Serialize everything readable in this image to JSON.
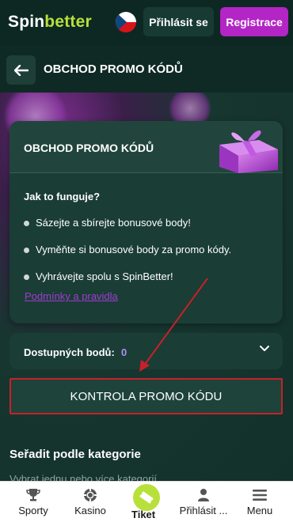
{
  "header": {
    "logo_part1": "Spin",
    "logo_part2": "better",
    "login_label": "Přihlásit se",
    "register_label": "Registrace",
    "flag_icon": "czech-flag-icon"
  },
  "page": {
    "title": "OBCHOD PROMO KÓDŮ",
    "back_icon": "arrow-left-icon"
  },
  "card": {
    "title": "OBCHOD PROMO KÓDŮ",
    "how_title": "Jak to funguje?",
    "bullets": [
      "Sázejte a sbírejte bonusové body!",
      "Vyměňte si bonusové body za promo kódy.",
      "Vyhrávejte spolu s SpinBetter!"
    ],
    "terms_link": "Podmínky a pravidla"
  },
  "points": {
    "label": "Dostupných bodů:",
    "value": "0"
  },
  "check_button": "KONTROLA PROMO KÓDU",
  "sort": {
    "title": "Seřadit podle kategorie",
    "placeholder": "Vybrat jednu nebo více kategorií"
  },
  "bottom_nav": {
    "items": [
      {
        "label": "Sporty",
        "icon": "trophy-icon"
      },
      {
        "label": "Kasino",
        "icon": "casino-chip-icon"
      },
      {
        "label": "Tiket",
        "icon": "ticket-icon"
      },
      {
        "label": "Přihlásit ...",
        "icon": "user-icon"
      },
      {
        "label": "Menu",
        "icon": "menu-icon"
      }
    ]
  },
  "colors": {
    "accent_green": "#b8e03a",
    "accent_purple": "#b325c4",
    "annotation_red": "#c8202a",
    "background": "#0f2a24"
  }
}
